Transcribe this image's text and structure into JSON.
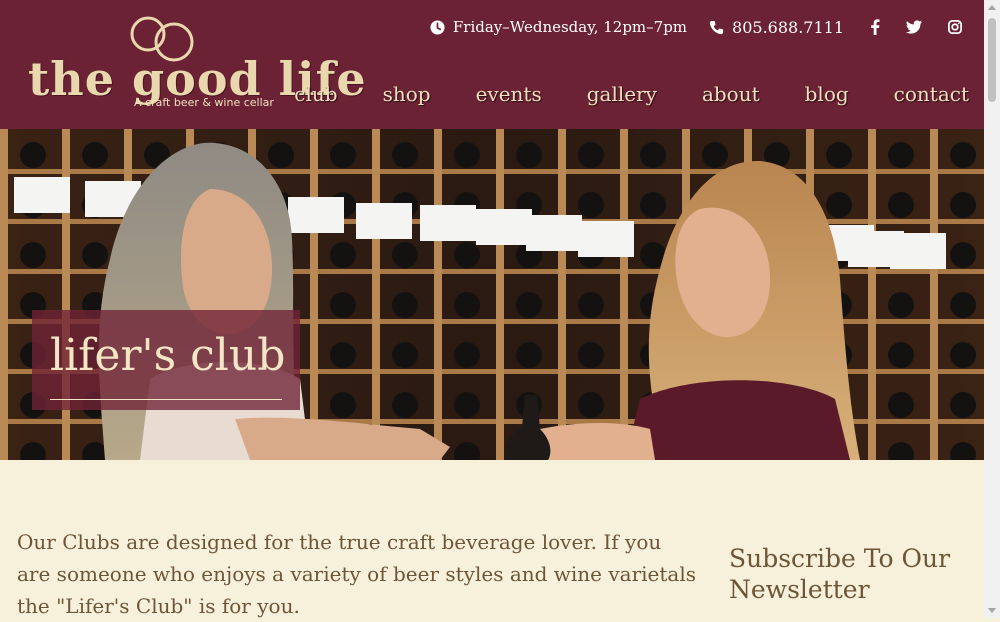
{
  "header": {
    "logo_text": "the good life",
    "logo_tagline": "A craft beer & wine cellar",
    "hours": "Friday–Wednesday, 12pm–7pm",
    "phone": "805.688.7111",
    "icons": {
      "hours": "clock-icon",
      "phone": "phone-icon",
      "social": [
        "facebook-icon",
        "twitter-icon",
        "instagram-icon"
      ]
    },
    "colors": {
      "background": "#6b2234",
      "nav_text": "#ece0bf"
    }
  },
  "nav": {
    "items": [
      "club",
      "shop",
      "events",
      "gallery",
      "about",
      "blog",
      "contact"
    ]
  },
  "hero": {
    "title": "lifer's club"
  },
  "main": {
    "intro": "Our Clubs are designed for the true craft beverage lover.  If you are someone who enjoys a variety of beer styles and wine varietals the \"Lifer's Club\" is for you."
  },
  "sidebar": {
    "newsletter_title": "Subscribe To Our Newsletter"
  },
  "colors": {
    "page_background": "#f7f0da",
    "body_text": "#6d5538"
  }
}
